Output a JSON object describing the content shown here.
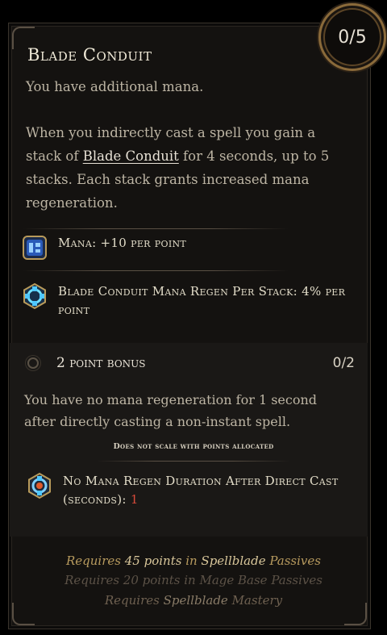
{
  "skill": {
    "title": "Blade Conduit",
    "points": "0/5",
    "desc_line": "You have additional mana.",
    "desc_pre": "When you indirectly cast a spell you gain a stack of ",
    "desc_keyword": "Blade Conduit",
    "desc_post": " for 4 seconds, up to 5 stacks. Each stack grants increased mana regeneration."
  },
  "stats": [
    {
      "icon": "mana-rune-icon",
      "text": "Mana: +10 per point"
    },
    {
      "icon": "mana-regen-icon",
      "text": "Blade Conduit Mana Regen Per Stack: 4% per point"
    }
  ],
  "bonus": {
    "label": "2 point bonus",
    "count": "0/2",
    "desc": "You have no mana regeneration for 1 second after directly casting a non-instant spell.",
    "note": "Does not scale with points allocated",
    "stat_label": "No Mana Regen Duration After Direct Cast (seconds): ",
    "stat_value": "1",
    "stat_icon": "regen-block-icon"
  },
  "requirements": [
    {
      "a": "Requires ",
      "b": "45 points",
      "c": " in ",
      "d": "Spellblade",
      "e": " ",
      "f": "Passives"
    },
    {
      "text": "Requires 20 points in Mage Base Passives"
    },
    {
      "a": "Requires ",
      "b": "Spellblade",
      "c": " Mastery"
    }
  ],
  "colors": {
    "accent_red": "#d94a3a",
    "gold": "#b79a5e"
  }
}
